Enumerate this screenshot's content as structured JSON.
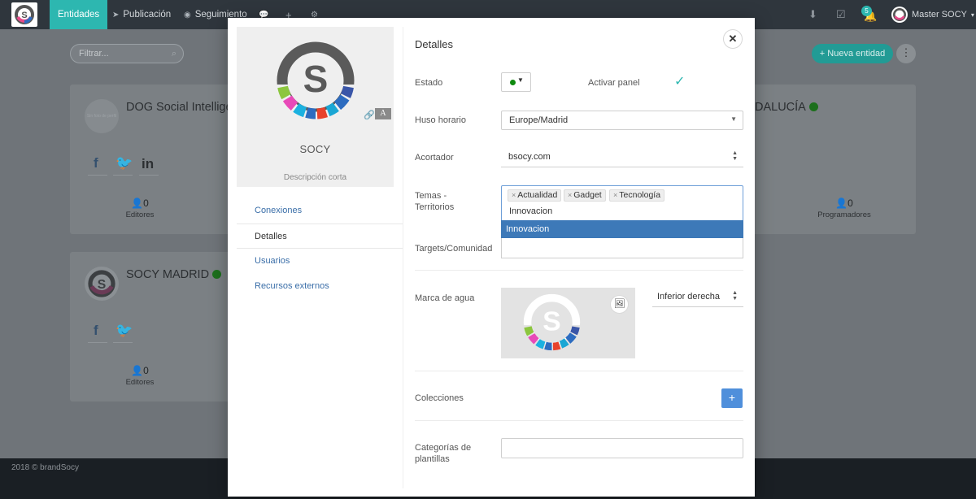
{
  "navbar": {
    "tabs": [
      {
        "label": "Entidades",
        "icon": "none",
        "active": true
      },
      {
        "label": "Publicación",
        "icon": "paper-plane-icon"
      },
      {
        "label": "Seguimiento",
        "icon": "target-icon"
      },
      {
        "label": "",
        "icon": "chat-icon"
      },
      {
        "label": "",
        "icon": "plus-icon"
      },
      {
        "label": "",
        "icon": "gear-icon"
      }
    ],
    "notification_count": "5",
    "user_name": "Master SOCY"
  },
  "background": {
    "filter_placeholder": "Filtrar...",
    "new_entity_label": "Nueva entidad",
    "cards": [
      {
        "title": "DOG Social Intellige",
        "avatar_text": "Sin foto de perfil",
        "stat_value": "0",
        "stat_label": "Editores"
      },
      {
        "title": "DALUCÍA",
        "stat_value": "0",
        "stat_label": "Programadores"
      },
      {
        "title": "SOCY MADRID",
        "stat_value": "0",
        "stat_label": "Editores"
      }
    ],
    "footer_text": "2018 © brandSocy"
  },
  "modal": {
    "profile": {
      "name": "SOCY",
      "description": "Descripción corta",
      "font_badge": "A"
    },
    "side_nav": [
      "Conexiones",
      "Detalles",
      "Usuarios",
      "Recursos externos"
    ],
    "section_title": "Detalles",
    "labels": {
      "estado": "Estado",
      "activar_panel": "Activar panel",
      "huso_horario": "Huso horario",
      "acortador": "Acortador",
      "temas_1": "Temas -",
      "temas_2": "Territorios",
      "targets": "Targets/Comunidad",
      "marca_agua": "Marca de agua",
      "colecciones": "Colecciones",
      "categorias_1": "Categorías de",
      "categorias_2": "plantillas"
    },
    "estado_color": "#0f8a0f",
    "timezone_value": "Europe/Madrid",
    "shortener_value": "bsocy.com",
    "tags": [
      "Actualidad",
      "Gadget",
      "Tecnología"
    ],
    "tag_input_value": "Innovacion",
    "dropdown_option": "Innovacion",
    "watermark_position": "Inferior derecha",
    "colors": {
      "accent": "#2db7b0",
      "selected": "#3d79b8",
      "add_button": "#4f8fdb"
    }
  }
}
